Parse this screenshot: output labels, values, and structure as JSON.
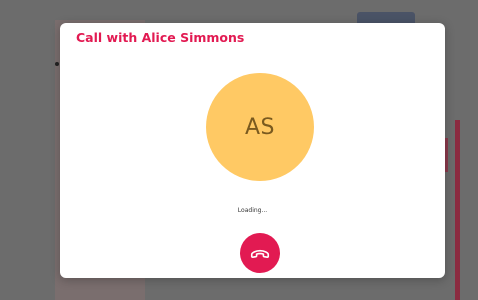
{
  "call": {
    "title": "Call with Alice Simmons",
    "initials": "AS",
    "status": "Loading..."
  },
  "colors": {
    "accent": "#e21a52",
    "avatar_bg": "#ffc964"
  },
  "icons": {
    "hangup": "phone-hangup-icon"
  }
}
